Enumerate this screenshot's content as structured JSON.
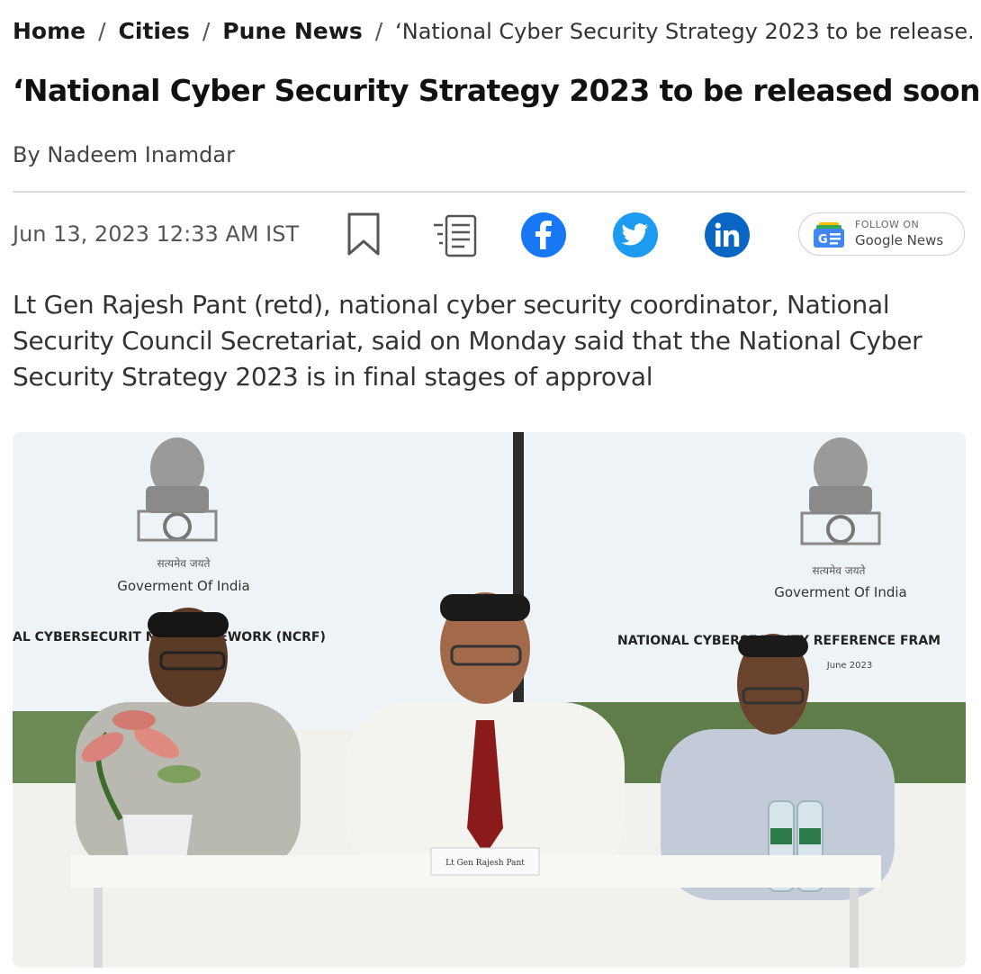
{
  "breadcrumb": {
    "items": [
      "Home",
      "Cities",
      "Pune News"
    ],
    "separator": "/",
    "current": "‘National Cyber Security Strategy 2023 to be release..."
  },
  "article": {
    "title": "‘National Cyber Security Strategy 2023 to be released soon’",
    "byline_prefix": "By",
    "author": "Nadeem Inamdar",
    "date": "Jun 13, 2023 12:33 AM IST",
    "summary": "Lt Gen Rajesh Pant (retd), national cyber security coordinator, National Security Council Secretariat, said on Monday said that the National Cyber Security Strategy 2023 is in final stages of approval"
  },
  "actions": {
    "bookmark_icon": "bookmark-icon",
    "readmode_icon": "reading-mode-icon",
    "share": [
      "facebook-icon",
      "twitter-icon",
      "linkedin-icon"
    ]
  },
  "google_news": {
    "follow_label": "FOLLOW ON",
    "brand_label": "Google News"
  },
  "photo": {
    "left_screen": {
      "devanagari": "सत्यमेव जयते",
      "gov": "Goverment Of India",
      "banner": "AL CYBERSECURIT         NCE FRAMEWORK (NCRF)"
    },
    "right_screen": {
      "devanagari": "सत्यमेव जयते",
      "gov": "Goverment Of India",
      "banner": "NATIONAL CYBERSECURITY REFERENCE FRAM",
      "date": "June 2023"
    },
    "nameplate": "Lt Gen Rajesh Pant"
  },
  "colors": {
    "facebook": "#1877f2",
    "twitter": "#1d9bf0",
    "linkedin": "#0a66c2"
  }
}
